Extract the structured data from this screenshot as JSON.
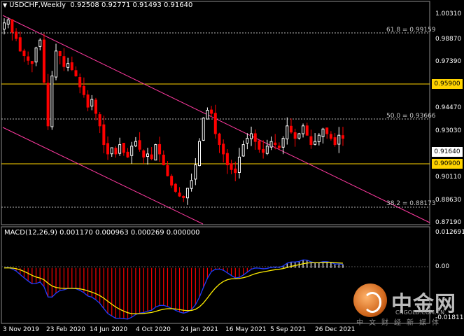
{
  "header": {
    "symbol_title": "USDCHF,Weekly",
    "ohlc": "0.92508 0.92771 0.91493 0.91640"
  },
  "macd": {
    "title": "MACD(12,26,9) 0.001170 0.000963 0.000269 0.000000"
  },
  "price_axis": [
    "1.00310",
    "0.98870",
    "0.97390",
    "0.94470",
    "0.93030",
    "0.90110",
    "0.88630",
    "0.87190"
  ],
  "macd_axis": [
    "0.012691",
    "0.00",
    "-0.018118"
  ],
  "time_axis": [
    "3 Nov 2019",
    "23 Feb 2020",
    "14 Jun 2020",
    "4 Oct 2020",
    "24 Jan 2021",
    "16 May 2021",
    "5 Sep 2021",
    "26 Dec 2021"
  ],
  "levels": {
    "fib618": "61.8 = 0.99159",
    "fib500": "50.0 = 0.93666",
    "fib382": "38.2 = 0.88173",
    "resistance": "0.95900",
    "support": "0.90900",
    "current": "0.91640"
  },
  "colors": {
    "bull": "#ffffff",
    "bear": "#ff0000",
    "channel": "#ff3aa0",
    "level": "#ffd400",
    "macd_main_pos": "#ffffff",
    "macd_main_neg": "#ff0000",
    "signal": "#ffee00",
    "histo_line": "#1e3cff"
  },
  "watermark": {
    "brand": "中金网",
    "url": "CNGOLD.COM.CN",
    "subtitle": "中文财经新媒体"
  },
  "chart_data": {
    "type": "candlestick",
    "title": "USDCHF,Weekly",
    "ylim": [
      0.868,
      1.008
    ],
    "x": [
      "3 Nov 2019",
      "23 Feb 2020",
      "14 Jun 2020",
      "4 Oct 2020",
      "24 Jan 2021",
      "16 May 2021",
      "5 Sep 2021",
      "26 Dec 2021"
    ],
    "close_path": [
      0.996,
      0.998,
      0.99,
      0.986,
      0.978,
      0.975,
      0.972,
      0.97,
      0.98,
      0.985,
      0.958,
      0.93,
      0.962,
      0.978,
      0.975,
      0.968,
      0.97,
      0.966,
      0.962,
      0.955,
      0.95,
      0.942,
      0.947,
      0.938,
      0.93,
      0.918,
      0.912,
      0.916,
      0.912,
      0.918,
      0.913,
      0.91,
      0.917,
      0.92,
      0.915,
      0.91,
      0.912,
      0.909,
      0.918,
      0.912,
      0.905,
      0.898,
      0.892,
      0.888,
      0.885,
      0.884,
      0.89,
      0.895,
      0.905,
      0.92,
      0.935,
      0.94,
      0.938,
      0.925,
      0.918,
      0.912,
      0.905,
      0.902,
      0.9,
      0.91,
      0.918,
      0.922,
      0.925,
      0.92,
      0.915,
      0.913,
      0.917,
      0.92,
      0.918,
      0.916,
      0.922,
      0.93,
      0.926,
      0.922,
      0.925,
      0.93,
      0.924,
      0.918,
      0.92,
      0.924,
      0.928,
      0.925,
      0.922,
      0.918,
      0.924,
      0.922
    ],
    "macd_range": [
      -0.018118,
      0.012691
    ]
  }
}
